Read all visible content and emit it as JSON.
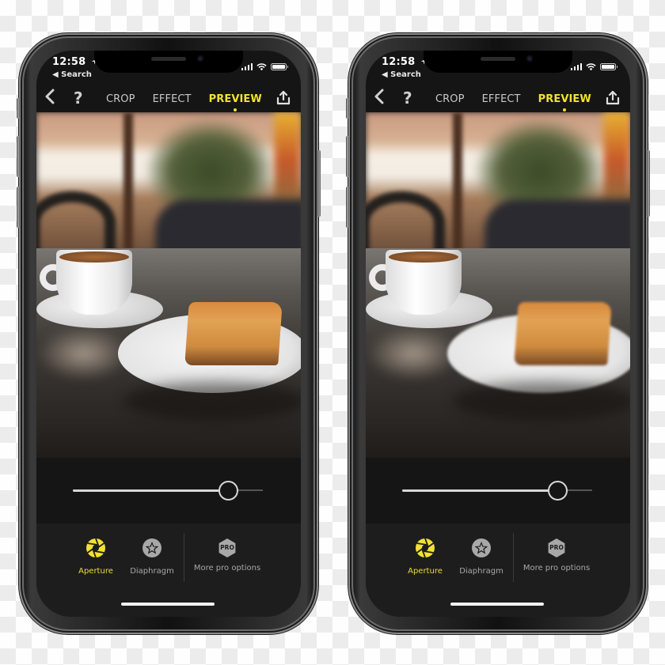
{
  "phones": [
    {
      "id": "left",
      "status": {
        "time": "12:58",
        "back_label": "◀ Search"
      },
      "toolbar": {
        "tabs": [
          {
            "label": "CROP",
            "active": false
          },
          {
            "label": "EFFECT",
            "active": false
          },
          {
            "label": "PREVIEW",
            "active": true
          }
        ]
      },
      "photo": {
        "description": "Coffee cup and slice of cake on cafe table, blurred background; cake in focus"
      },
      "slider": {
        "value": 0.82
      },
      "options": [
        {
          "label": "Aperture",
          "icon": "aperture-icon",
          "active": true
        },
        {
          "label": "Diaphragm",
          "icon": "diaphragm-star-icon",
          "active": false
        },
        {
          "label": "More pro options",
          "icon": "pro-hexagon-icon",
          "badge": "PRO",
          "active": false
        }
      ]
    },
    {
      "id": "right",
      "status": {
        "time": "12:58",
        "back_label": "◀ Search"
      },
      "toolbar": {
        "tabs": [
          {
            "label": "CROP",
            "active": false
          },
          {
            "label": "EFFECT",
            "active": false
          },
          {
            "label": "PREVIEW",
            "active": true
          }
        ]
      },
      "photo": {
        "description": "Coffee cup and slice of cake on cafe table, blurred background; cup in focus"
      },
      "slider": {
        "value": 0.82
      },
      "options": [
        {
          "label": "Aperture",
          "icon": "aperture-icon",
          "active": true
        },
        {
          "label": "Diaphragm",
          "icon": "diaphragm-star-icon",
          "active": false
        },
        {
          "label": "More pro options",
          "icon": "pro-hexagon-icon",
          "badge": "PRO",
          "active": false
        }
      ]
    }
  ],
  "icons": {
    "back": "‹",
    "help": "?",
    "location": "➤"
  },
  "colors": {
    "accent": "#f2e232",
    "screen_bg": "#151515",
    "options_bg": "#1d1d1d",
    "inactive_text": "#a8a8a8"
  }
}
